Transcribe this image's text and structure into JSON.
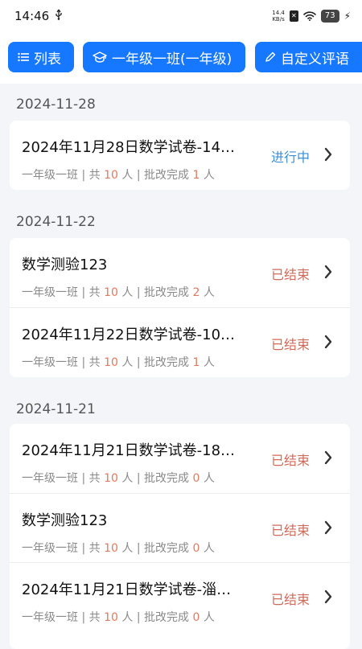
{
  "status_bar": {
    "time": "14:46",
    "net_speed_value": "14.4",
    "net_speed_unit": "KB/s",
    "battery": "73"
  },
  "toolbar": {
    "list_label": "列表",
    "class_label": "一年级一班(一年级)",
    "custom_label": "自定义评语"
  },
  "colors": {
    "primary": "#1677ff",
    "ongoing": "#3a8fd6",
    "ended": "#d06a5a",
    "count": "#e07a5f"
  },
  "meta_labels": {
    "sep": "|",
    "total_prefix": "共",
    "person": "人",
    "graded_prefix": "批改完成"
  },
  "groups": [
    {
      "date": "2024-11-28",
      "items": [
        {
          "title": "2024年11月28日数学试卷-14…",
          "class": "一年级一班",
          "total": "10",
          "graded": "1",
          "status": "进行中",
          "status_type": "ongoing"
        }
      ]
    },
    {
      "date": "2024-11-22",
      "items": [
        {
          "title": "数学测验123",
          "class": "一年级一班",
          "total": "10",
          "graded": "2",
          "status": "已结束",
          "status_type": "ended"
        },
        {
          "title": "2024年11月22日数学试卷-10…",
          "class": "一年级一班",
          "total": "10",
          "graded": "1",
          "status": "已结束",
          "status_type": "ended"
        }
      ]
    },
    {
      "date": "2024-11-21",
      "items": [
        {
          "title": "2024年11月21日数学试卷-18…",
          "class": "一年级一班",
          "total": "10",
          "graded": "0",
          "status": "已结束",
          "status_type": "ended"
        },
        {
          "title": "数学测验123",
          "class": "一年级一班",
          "total": "10",
          "graded": "0",
          "status": "已结束",
          "status_type": "ended"
        },
        {
          "title": "2024年11月21日数学试卷-淄…",
          "class": "一年级一班",
          "total": "10",
          "graded": "0",
          "status": "已结束",
          "status_type": "ended"
        }
      ]
    }
  ]
}
